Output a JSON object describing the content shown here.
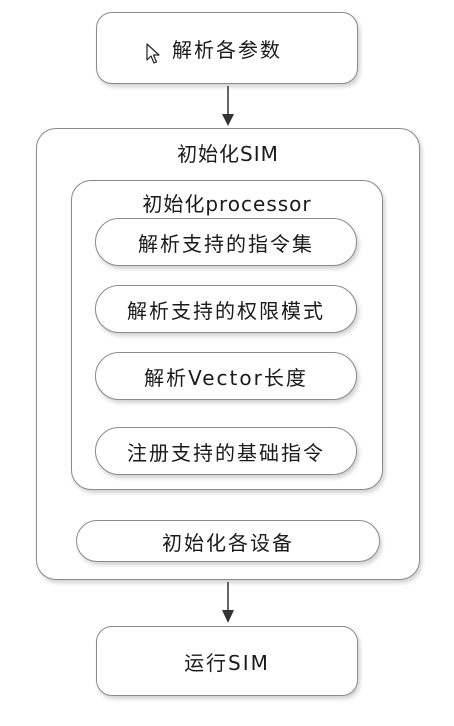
{
  "steps": {
    "parse_params": "解析各参数",
    "init_sim": "初始化SIM",
    "init_processor": "初始化processor",
    "parse_isa": "解析支持的指令集",
    "parse_priv": "解析支持的权限模式",
    "parse_vector": "解析Vector长度",
    "register_insn": "注册支持的基础指令",
    "init_devices": "初始化各设备",
    "run_sim": "运行SIM"
  },
  "colors": {
    "border": "#8a8a8a",
    "arrow": "#333333",
    "text": "#1a1a1a"
  },
  "icons": {
    "cursor": "mouse-pointer-icon"
  }
}
